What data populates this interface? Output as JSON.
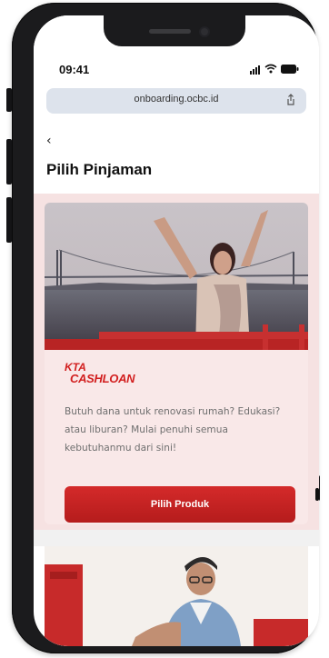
{
  "status": {
    "time": "09:41"
  },
  "browser": {
    "url": "onboarding.ocbc.id"
  },
  "page": {
    "back_symbol": "‹",
    "title": "Pilih Pinjaman"
  },
  "product_card": {
    "logo_line1": "KTA",
    "logo_line2": "CASHLOAN",
    "description": "Butuh dana untuk renovasi rumah? Edukasi? atau liburan? Mulai penuhi semua kebutuhanmu dari sini!",
    "cta_label": "Pilih Produk"
  },
  "colors": {
    "accent": "#c62222",
    "card_bg": "#f9e8e8",
    "section_bg": "#f6e2e2"
  },
  "icons": [
    "signal-icon",
    "wifi-icon",
    "battery-icon",
    "share-icon",
    "back-icon"
  ]
}
